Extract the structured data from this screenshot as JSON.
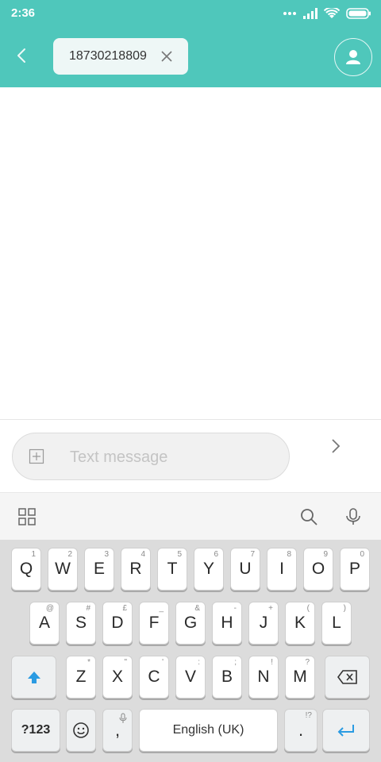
{
  "status_bar": {
    "time": "2:36"
  },
  "header": {
    "recipient_chip": "18730218809"
  },
  "composer": {
    "placeholder": "Text message"
  },
  "keyboard": {
    "row1": [
      {
        "label": "Q",
        "hint": "1"
      },
      {
        "label": "W",
        "hint": "2"
      },
      {
        "label": "E",
        "hint": "3"
      },
      {
        "label": "R",
        "hint": "4"
      },
      {
        "label": "T",
        "hint": "5"
      },
      {
        "label": "Y",
        "hint": "6"
      },
      {
        "label": "U",
        "hint": "7"
      },
      {
        "label": "I",
        "hint": "8"
      },
      {
        "label": "O",
        "hint": "9"
      },
      {
        "label": "P",
        "hint": "0"
      }
    ],
    "row2": [
      {
        "label": "A",
        "hint": "@"
      },
      {
        "label": "S",
        "hint": "#"
      },
      {
        "label": "D",
        "hint": "£"
      },
      {
        "label": "F",
        "hint": "_"
      },
      {
        "label": "G",
        "hint": "&"
      },
      {
        "label": "H",
        "hint": "-"
      },
      {
        "label": "J",
        "hint": "+"
      },
      {
        "label": "K",
        "hint": "("
      },
      {
        "label": "L",
        "hint": ")"
      }
    ],
    "row3": [
      {
        "label": "Z",
        "hint": "*"
      },
      {
        "label": "X",
        "hint": "\""
      },
      {
        "label": "C",
        "hint": "'"
      },
      {
        "label": "V",
        "hint": ":"
      },
      {
        "label": "B",
        "hint": ";"
      },
      {
        "label": "N",
        "hint": "!"
      },
      {
        "label": "M",
        "hint": "?"
      }
    ],
    "symbols_key": "?123",
    "comma_key": ",",
    "space_label": "English (UK)",
    "period_key": ".",
    "period_hint": "!?"
  },
  "colors": {
    "header": "#4fc7bb",
    "accent_blue": "#2a9be2",
    "keyboard_bg": "#dcdcdc"
  },
  "icons": [
    "back-arrow-icon",
    "close-icon",
    "contact-icon",
    "add-attachment-icon",
    "send-chevron-icon",
    "apps-grid-icon",
    "search-icon",
    "mic-icon",
    "shift-icon",
    "backspace-icon",
    "emoji-icon",
    "enter-icon",
    "signal-icon",
    "wifi-icon",
    "battery-icon"
  ]
}
